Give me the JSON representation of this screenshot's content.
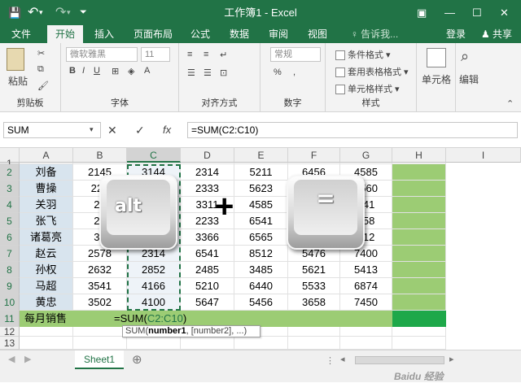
{
  "title": "工作簿1 - Excel",
  "qat": {
    "save_icon": "💾",
    "undo_icon": "↶",
    "redo_icon": "↷"
  },
  "window": {
    "ribbon_opts_icon": "▣",
    "minimize": "—",
    "maximize": "☐",
    "close": "✕"
  },
  "tabs": [
    "文件",
    "开始",
    "插入",
    "页面布局",
    "公式",
    "数据",
    "审阅",
    "视图"
  ],
  "tell_me": "♀ 告诉我...",
  "login": "登录",
  "share": "♟ 共享",
  "ribbon": {
    "paste_label": "粘贴",
    "font_name": "微软雅黑",
    "font_size": "11",
    "number_format": "常规",
    "cond_format": "条件格式 ▾",
    "table_format": "套用表格格式 ▾",
    "cell_style": "单元格样式 ▾",
    "cells_label": "单元格",
    "edit_label": "编辑",
    "groups": {
      "clipboard": "剪贴板",
      "font": "字体",
      "align": "对齐方式",
      "number": "数字",
      "styles": "样式"
    }
  },
  "formula_bar": {
    "name_box": "SUM",
    "cancel": "✕",
    "enter": "✓",
    "fx": "fx",
    "formula": "=SUM(C2:C10)"
  },
  "columns": [
    "A",
    "B",
    "C",
    "D",
    "E",
    "F",
    "G",
    "H",
    "I"
  ],
  "rows": [
    "1",
    "2",
    "3",
    "4",
    "5",
    "6",
    "7",
    "8",
    "9",
    "10",
    "11",
    "12",
    "13"
  ],
  "names": [
    "刘备",
    "曹操",
    "关羽",
    "张飞",
    "诸葛亮",
    "赵云",
    "孙权",
    "马超",
    "黄忠"
  ],
  "table": [
    [
      "2145",
      "3144",
      "2314",
      "5211",
      "6456",
      "4585"
    ],
    [
      "220",
      "",
      "2333",
      "5623",
      "",
      "5560"
    ],
    [
      "25",
      "",
      "3311",
      "4585",
      "",
      "541"
    ],
    [
      "23",
      "",
      "2233",
      "6541",
      "",
      "658"
    ],
    [
      "32",
      "",
      "3366",
      "6565",
      "",
      "412"
    ],
    [
      "2578",
      "2314",
      "6541",
      "8512",
      "5476",
      "7400"
    ],
    [
      "2632",
      "2852",
      "2485",
      "3485",
      "5621",
      "5413"
    ],
    [
      "3541",
      "4166",
      "5210",
      "6440",
      "5533",
      "6874"
    ],
    [
      "3502",
      "4100",
      "5647",
      "5456",
      "3658",
      "7450"
    ]
  ],
  "total_row": {
    "label": "每月销售",
    "formula_prefix": "=SUM(",
    "formula_range": "C2:C10",
    "formula_suffix": ")"
  },
  "tooltip": {
    "func": "SUM(",
    "arg1": "number1",
    "rest": ", [number2], ...)"
  },
  "keys": {
    "alt": "alt",
    "plus": "+",
    "equals": "="
  },
  "sheet_tab": "Sheet1",
  "watermark": "Baidu 经验",
  "colors": {
    "excel_green": "#217346",
    "highlight_green": "#9ccc74",
    "bright_green": "#1ea84a",
    "dash_green": "#217346"
  }
}
